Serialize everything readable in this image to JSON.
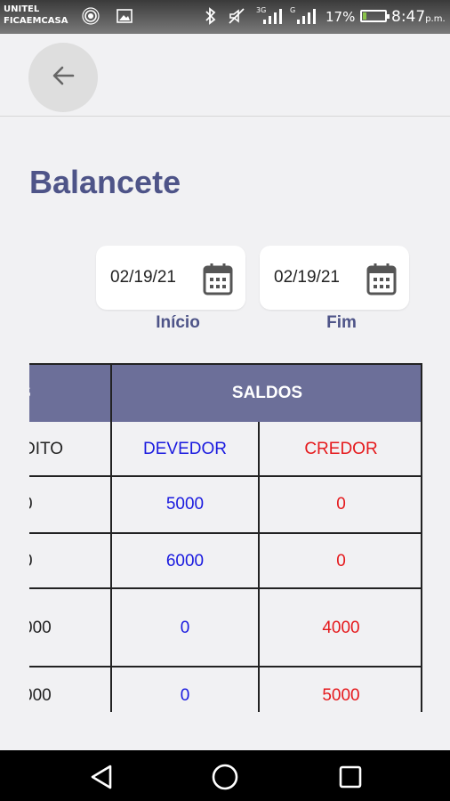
{
  "status_bar": {
    "carrier_line1": "UNITEL",
    "carrier_line2": "FICAEMCASA",
    "network_1": "3G",
    "network_2": "G",
    "battery_percent": "17%",
    "battery_level": 0.17,
    "time": "8:47",
    "ampm": "p.m.",
    "icons": [
      "hotspot-icon",
      "image-icon",
      "bluetooth-icon",
      "mute-icon",
      "signal-icon",
      "signal-icon",
      "battery-icon"
    ]
  },
  "page": {
    "title": "Balancete",
    "back_icon": "arrow-left-icon"
  },
  "dates": {
    "start_value": "02/19/21",
    "start_label": "Início",
    "end_value": "02/19/21",
    "end_label": "Fim",
    "icon": "calendar-icon"
  },
  "table": {
    "group_header_left": "S",
    "group_header": "SALDOS",
    "columns": {
      "left_partial": "DITO",
      "devedor": "DEVEDOR",
      "credor": "CREDOR"
    },
    "rows": [
      {
        "left": "0",
        "devedor": "5000",
        "credor": "0"
      },
      {
        "left": "0",
        "devedor": "6000",
        "credor": "0"
      },
      {
        "left": "000",
        "devedor": "0",
        "credor": "4000"
      },
      {
        "left": "000",
        "devedor": "0",
        "credor": "5000"
      }
    ],
    "colors": {
      "devedor": "#1a1adf",
      "credor": "#e5191c",
      "header": "#6c6f99"
    }
  },
  "nav": {
    "back_icon": "triangle-back-icon",
    "home_icon": "circle-home-icon",
    "recents_icon": "square-recents-icon"
  }
}
